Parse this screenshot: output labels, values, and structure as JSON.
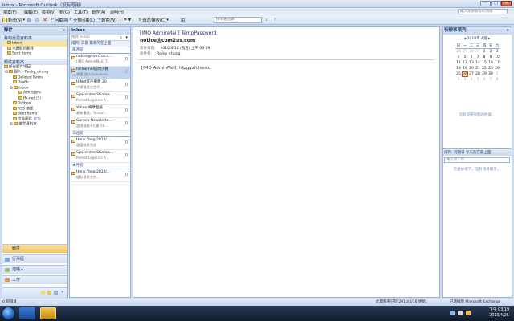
{
  "window": {
    "title": "Inbox - Microsoft Outlook（没有写用）"
  },
  "menu": [
    "檔案(F)",
    "編輯(E)",
    "檢視(V)",
    "到(G)",
    "工具(T)",
    "動作(A)",
    "說明(H)"
  ],
  "help_placeholder": "輸入需要解答的問題",
  "toolbar": {
    "new": "新增(N)",
    "reply": "回覆(R)",
    "reply_all": "全部回覆(L)",
    "forward": "轉寄(W)",
    "send_receive": "傳送/接收(C)",
    "search_placeholder": "搜尋通訊錄"
  },
  "nav": {
    "title": "郵件",
    "favorites_head": "我的最愛資料夾",
    "favorites": [
      "Inbox",
      "未讀取的郵件",
      "Sent Items"
    ],
    "mail_folders_head": "郵件資料夾",
    "all_items": "所有郵件項目",
    "tree": [
      {
        "label": "個人 - Rocky_chung",
        "level": 0
      },
      {
        "label": "Deleted Items",
        "level": 1
      },
      {
        "label": "Drafts",
        "level": 1
      },
      {
        "label": "Inbox",
        "level": 1
      },
      {
        "label": "APP Store",
        "level": 2
      },
      {
        "label": "IM-net",
        "count": "(5)",
        "level": 2
      },
      {
        "label": "Outbox",
        "level": 1
      },
      {
        "label": "RSS 摘要",
        "level": 1
      },
      {
        "label": "Sent Items",
        "level": 1
      },
      {
        "label": "垃圾郵件",
        "count": "(22)",
        "level": 1
      },
      {
        "label": "搜尋資料夾",
        "level": 1
      }
    ],
    "buttons": [
      "郵件",
      "行事曆",
      "連絡人",
      "工作"
    ]
  },
  "list": {
    "title": "Inbox",
    "search_placeholder": "搜尋 Inbox",
    "sort": "排列: 日期    最新的在上面",
    "groups": [
      {
        "head": "兩週前",
        "items": [
          {
            "from": "notice@com2us.c...",
            "subject": "[IMO AdminMail] T..."
          },
          {
            "from": "hichannel訪問小教",
            "subject": "恭喜!加入hichannel..."
          },
          {
            "from": "HiNet客戶服務 20...",
            "subject": "中華電信光世代..."
          },
          {
            "from": "Spacetime Studios...",
            "subject": "Pocket Legends A..."
          },
          {
            "from": "Yahoo!奇摩超級...",
            "subject": "最新優惠、Yahoo!..."
          },
          {
            "from": "Garena Newslette...",
            "subject": "超限餐殺+七星 20..."
          }
        ]
      },
      {
        "head": "三週前",
        "items": [
          {
            "from": "Honk Yang  2010/...",
            "subject": "儲值收款完成"
          },
          {
            "from": "Spacetime Studios...",
            "subject": "Pocket Legends A..."
          }
        ]
      },
      {
        "head": "本月初",
        "items": [
          {
            "from": "Honk Yang  2010/...",
            "subject": "儲存退款合約..."
          }
        ]
      }
    ]
  },
  "reading": {
    "subject": "[IMO AdminMail] TempPassword",
    "sender": "notice@com2us.com",
    "sent_label": "寄件日期:",
    "sent_value": "2010/4/16 (週五) 上午 09:19",
    "to_label": "收件者:",
    "to_value": "Rocky_chung",
    "body": "[IMO AdminMail] hlpgqxfcIsssiu"
  },
  "todo": {
    "title": "待辦事項列",
    "month": "2010年 4月",
    "weekdays": [
      "日",
      "一",
      "二",
      "三",
      "四",
      "五",
      "六"
    ],
    "days": [
      {
        "d": "28",
        "dim": true
      },
      {
        "d": "29",
        "dim": true
      },
      {
        "d": "30",
        "dim": true
      },
      {
        "d": "31",
        "dim": true
      },
      {
        "d": "1"
      },
      {
        "d": "2"
      },
      {
        "d": "3"
      },
      {
        "d": "4"
      },
      {
        "d": "5"
      },
      {
        "d": "6"
      },
      {
        "d": "7"
      },
      {
        "d": "8"
      },
      {
        "d": "9"
      },
      {
        "d": "10"
      },
      {
        "d": "11"
      },
      {
        "d": "12"
      },
      {
        "d": "13"
      },
      {
        "d": "14"
      },
      {
        "d": "15"
      },
      {
        "d": "16"
      },
      {
        "d": "17"
      },
      {
        "d": "18"
      },
      {
        "d": "19"
      },
      {
        "d": "20"
      },
      {
        "d": "21"
      },
      {
        "d": "22"
      },
      {
        "d": "23"
      },
      {
        "d": "24"
      },
      {
        "d": "25"
      },
      {
        "d": "26",
        "today": true
      },
      {
        "d": "27"
      },
      {
        "d": "28"
      },
      {
        "d": "29"
      },
      {
        "d": "30"
      },
      {
        "d": "1",
        "dim": true
      },
      {
        "d": "2",
        "dim": true
      },
      {
        "d": "3",
        "dim": true
      },
      {
        "d": "4",
        "dim": true
      },
      {
        "d": "5",
        "dim": true
      },
      {
        "d": "6",
        "dim": true
      },
      {
        "d": "7",
        "dim": true
      },
      {
        "d": "8",
        "dim": true
      }
    ],
    "no_appointments": "沒有即將來臨的約會。",
    "tasks_sort": "排列: 到期日   今天的在最上面",
    "new_task_placeholder": "輸入新工作",
    "no_tasks": "在此檢視下，沒有項目顯示。"
  },
  "status": {
    "items": "0 個項目",
    "updated": "此資料夾已於 2010/4/16 更新。",
    "connection": "已連線到 Microsoft Exchange"
  },
  "taskbar": {
    "time": "下午 03:19",
    "date": "2010/4/26"
  },
  "colors": {
    "accent": "#c1d3ee",
    "pane_border": "#9fb4d3"
  }
}
